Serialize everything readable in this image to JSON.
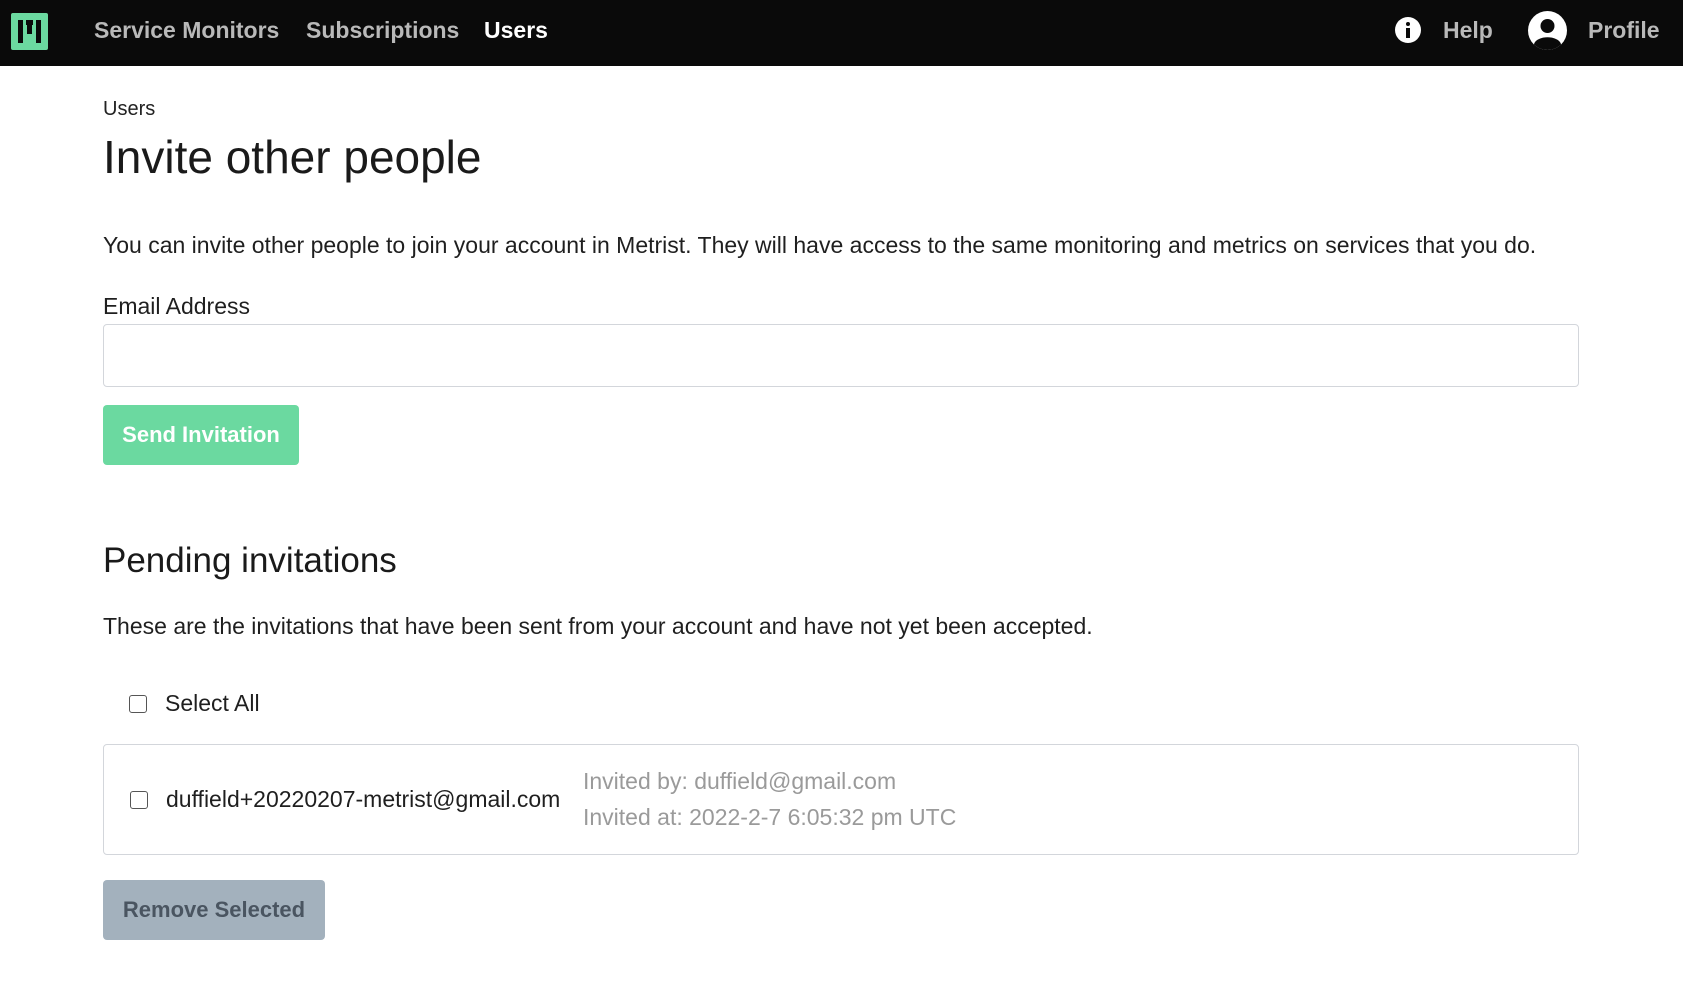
{
  "colors": {
    "brand": "#6bd9a0",
    "topbar": "#0a0a0a",
    "disabled_button": "#a3b1bd"
  },
  "nav": {
    "logo_icon": "metrist-logo-icon",
    "links": [
      {
        "label": "Service Monitors",
        "active": false
      },
      {
        "label": "Subscriptions",
        "active": false
      },
      {
        "label": "Users",
        "active": true
      }
    ],
    "help": {
      "label": "Help",
      "icon": "info-icon"
    },
    "profile": {
      "label": "Profile",
      "icon": "user-circle-icon"
    }
  },
  "page": {
    "breadcrumb": "Users",
    "title": "Invite other people",
    "intro": "You can invite other people to join your account in Metrist. They will have access to the same monitoring and metrics on services that you do."
  },
  "invite_form": {
    "email_label": "Email Address",
    "email_value": "",
    "send_label": "Send Invitation"
  },
  "pending": {
    "title": "Pending invitations",
    "description": "These are the invitations that have been sent from your account and have not yet been accepted.",
    "select_all_label": "Select All",
    "invitations": [
      {
        "email": "duffield+20220207-metrist@gmail.com",
        "invited_by": "Invited by: duffield@gmail.com",
        "invited_at": "Invited at: 2022-2-7 6:05:32 pm UTC",
        "checked": false
      }
    ],
    "remove_label": "Remove Selected"
  }
}
